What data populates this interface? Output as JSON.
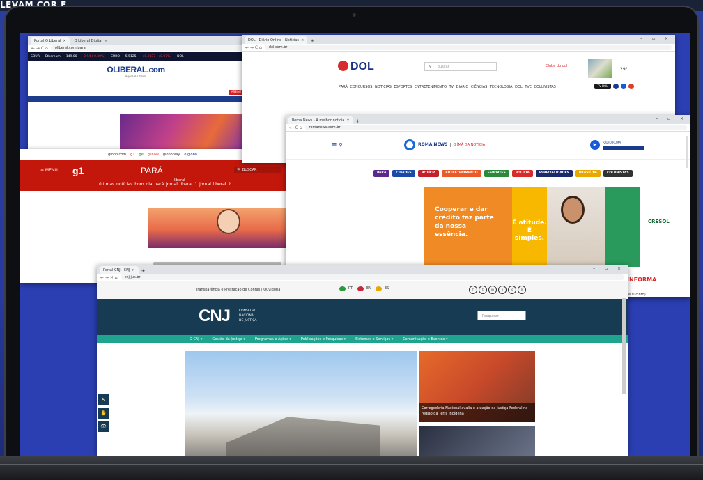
{
  "backdrop": {
    "banner_text": "LEVAM COR E"
  },
  "liberal": {
    "tabs": [
      "Portal O Liberal",
      "O Liberal Digital"
    ],
    "url": "oliberal.com/para",
    "ticker": [
      "SOUR",
      "Ethereum",
      "149.00",
      "-0.94 (-0.30%)",
      "EURO",
      "5,5125",
      "+0.0037 (+0.07%)",
      "DOL"
    ],
    "logo": "OLIBERAL.com",
    "tagline": "Agora é Liberal",
    "red_tag": "ASSINE"
  },
  "g1": {
    "globo_bar": [
      "globo.com",
      "g1",
      "ge",
      "gshow",
      "globoplay",
      "o globo"
    ],
    "menu": "≡ MENU",
    "logo": "g1",
    "region": "PARÁ",
    "affiliate": "liberal",
    "search": "🔍 BUSCAR",
    "links": "últimas notícias   bom dia pará   jornal liberal 1   jornal liberal 2"
  },
  "dol": {
    "tab": "DOL - Diário Online - Notícias",
    "url": "dol.com.br",
    "logo": "DOL",
    "search_placeholder": "Buscar",
    "club": "Clube do dol",
    "weather": "29°",
    "menu": "PARÁ  CONCURSOS  NOTÍCIAS  ESPORTES  ENTRETENIMENTO  TV DIÁRIO  CIÊNCIAS  TECNOLOGIA  DOL TVE  COLUNISTAS",
    "tv": "TV DOL"
  },
  "roma": {
    "tab": "Roma News - A melhor notícia",
    "url": "romanews.com.br",
    "logo_a": "ROMA NEWS",
    "logo_b": "O ÍMÃ DA NOTÍCIA",
    "radio": "RÁDIO ROMA",
    "categories": [
      {
        "label": "PARÁ",
        "color": "#5a2a8a"
      },
      {
        "label": "CIDADES",
        "color": "#1a4aa8"
      },
      {
        "label": "NOTÍCIA",
        "color": "#c2202a"
      },
      {
        "label": "ENTRETENIMENTO",
        "color": "#e85a2a"
      },
      {
        "label": "ESPORTES",
        "color": "#2a8a3a"
      },
      {
        "label": "POLÍCIA",
        "color": "#d82a2a"
      },
      {
        "label": "ESPECIALIDADES",
        "color": "#1a2a6a"
      },
      {
        "label": "BRASIL/PA",
        "color": "#e8a800"
      },
      {
        "label": "COLUNISTAS",
        "color": "#333333"
      }
    ],
    "ad_text_a": "Cooperar e dar crédito faz parte da nossa essência.",
    "ad_text_b": "É atitude. É simples.",
    "sponsor": "CRESOL",
    "inform_label": "INFORMA",
    "article_snippet": "(e sucinto) ..."
  },
  "cnj": {
    "tab": "Portal CNJ - CNJ",
    "url": "cnj.jus.br",
    "util_left": "Transparência e Prestação de Contas  |  Ouvidoria",
    "lang": [
      "PT",
      "EN",
      "ES"
    ],
    "social": [
      "f",
      "t",
      "in",
      "y",
      "ig",
      "li"
    ],
    "logo": "CNJ",
    "logo_text": [
      "CONSELHO",
      "NACIONAL",
      "DE JUSTIÇA"
    ],
    "search_placeholder": "Pesquisar",
    "nav": [
      "O CNJ ▾",
      "Gestão da Justiça ▾",
      "Programas e Ações ▾",
      "Publicações e Pesquisas ▾",
      "Sistemas e Serviços ▾",
      "Comunicação e Eventos ▾"
    ],
    "side_caption": "Corregedoria Nacional avalia e atuação da Justiça Federal na região da Terra Indígena",
    "a11y": [
      "♿",
      "✋",
      "👁"
    ]
  },
  "colors": {
    "cnj_navy": "#173b53",
    "cnj_teal": "#1fa58f",
    "g1_red": "#c4170c",
    "dol_blue": "#1a2f87"
  }
}
